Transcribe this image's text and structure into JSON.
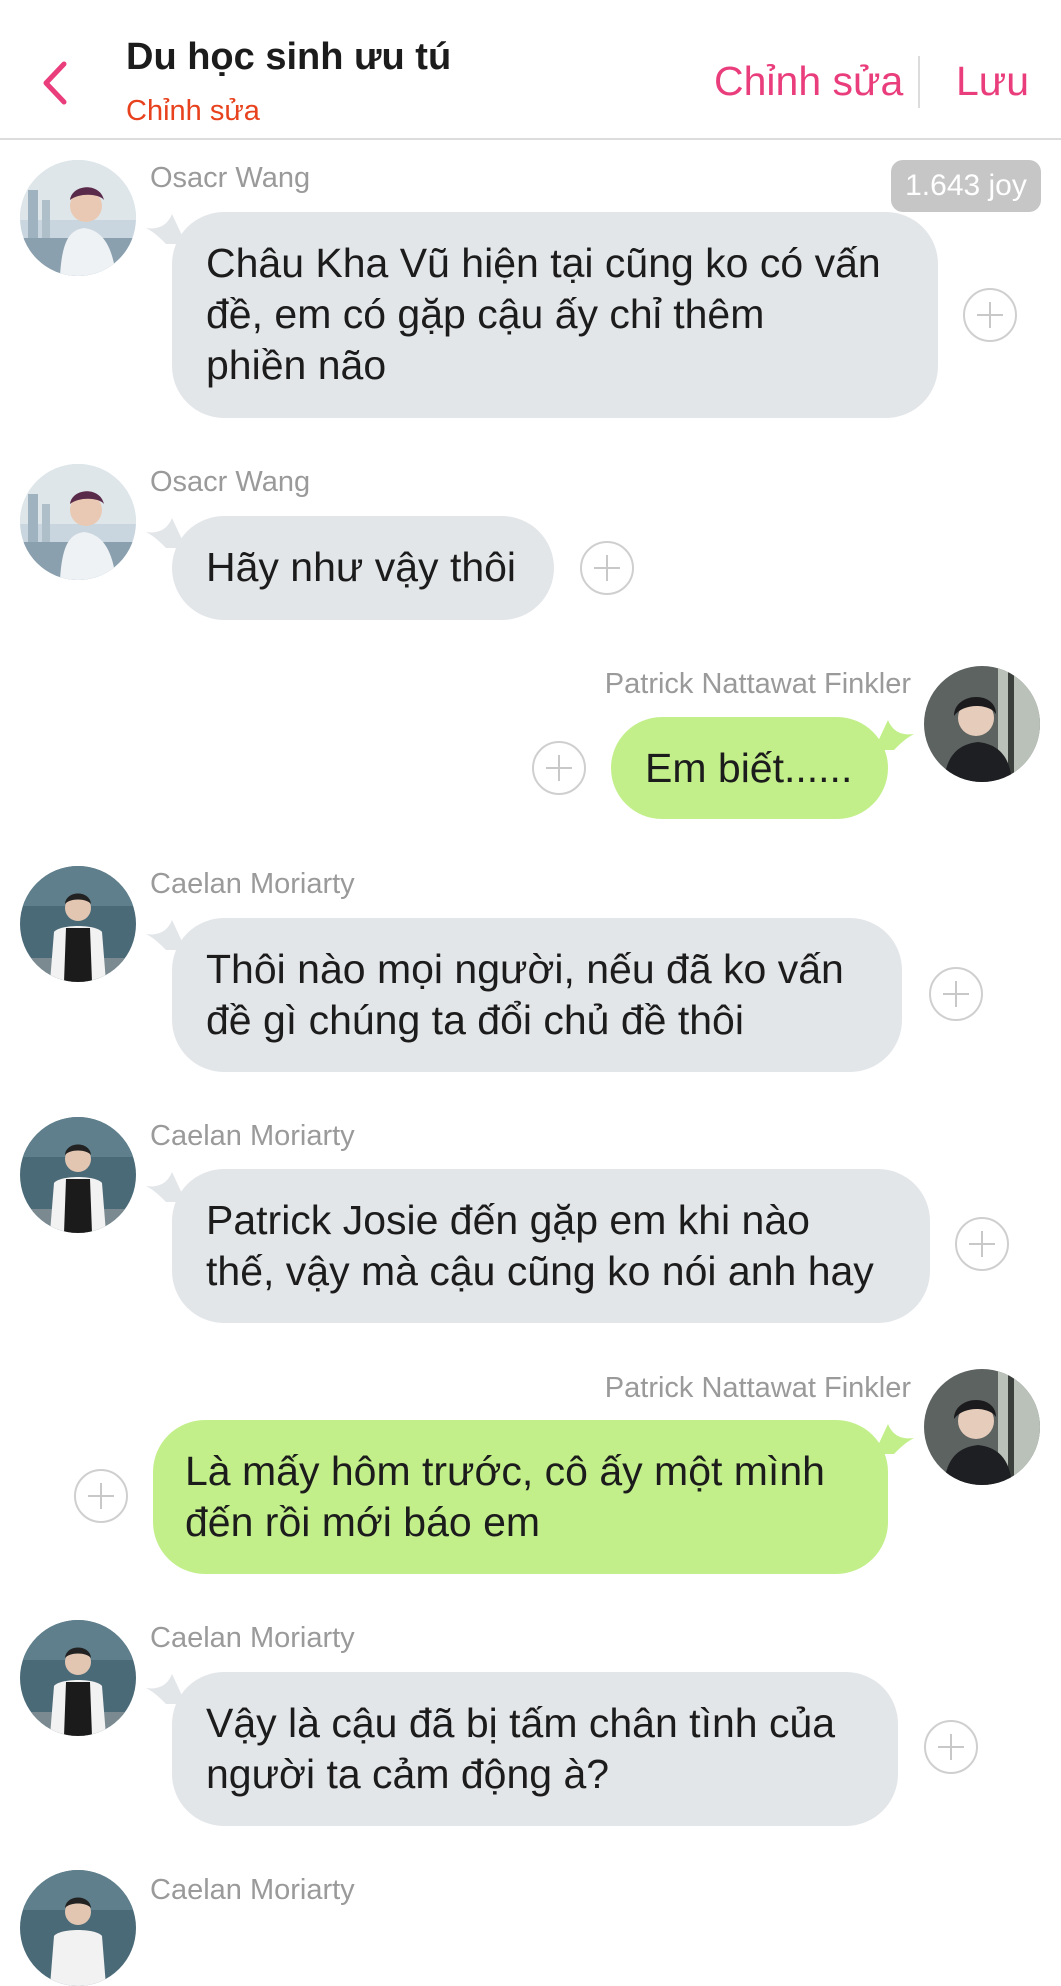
{
  "header": {
    "title": "Du học sinh ưu tú",
    "subtitle": "Chỉnh sửa",
    "edit_label": "Chỉnh sửa",
    "save_label": "Lưu",
    "back_icon": "chevron-left-icon",
    "accent_color": "#ea3d7c",
    "subtitle_color": "#e8411d"
  },
  "badge": {
    "text": "1.643 joy"
  },
  "messages": [
    {
      "sender": "Osacr Wang",
      "side": "left",
      "text_lines": [
        "Châu Kha Vũ hiện tại cũng ko có vấn",
        "đề, em có gặp cậu ấy chỉ thêm",
        "phiền não"
      ]
    },
    {
      "sender": "Osacr Wang",
      "side": "left",
      "text_lines": [
        "Hãy như vậy thôi"
      ]
    },
    {
      "sender": "Patrick Nattawat Finkler",
      "side": "right",
      "text_lines": [
        "Em biết......"
      ]
    },
    {
      "sender": "Caelan Moriarty",
      "side": "left",
      "text_lines": [
        "Thôi nào mọi người, nếu đã ko vấn",
        "đề gì chúng ta đổi chủ đề thôi"
      ]
    },
    {
      "sender": "Caelan Moriarty",
      "side": "left",
      "text_lines": [
        "Patrick Josie đến gặp em khi nào",
        "thế, vậy mà cậu cũng ko nói anh hay"
      ]
    },
    {
      "sender": "Patrick Nattawat Finkler",
      "side": "right",
      "text_lines": [
        "Là mấy hôm trước, cô ấy một mình",
        "đến rồi mới báo em"
      ]
    },
    {
      "sender": "Caelan Moriarty",
      "side": "left",
      "text_lines": [
        "Vậy là cậu đã bị tấm chân tình của",
        "người ta cảm động à?"
      ]
    },
    {
      "sender": "Caelan Moriarty",
      "side": "left",
      "text_lines": []
    }
  ],
  "colors": {
    "incoming_bubble": "#e3e6e9",
    "outgoing_bubble": "#c2ef8a",
    "name_text": "#9a9a9a"
  }
}
